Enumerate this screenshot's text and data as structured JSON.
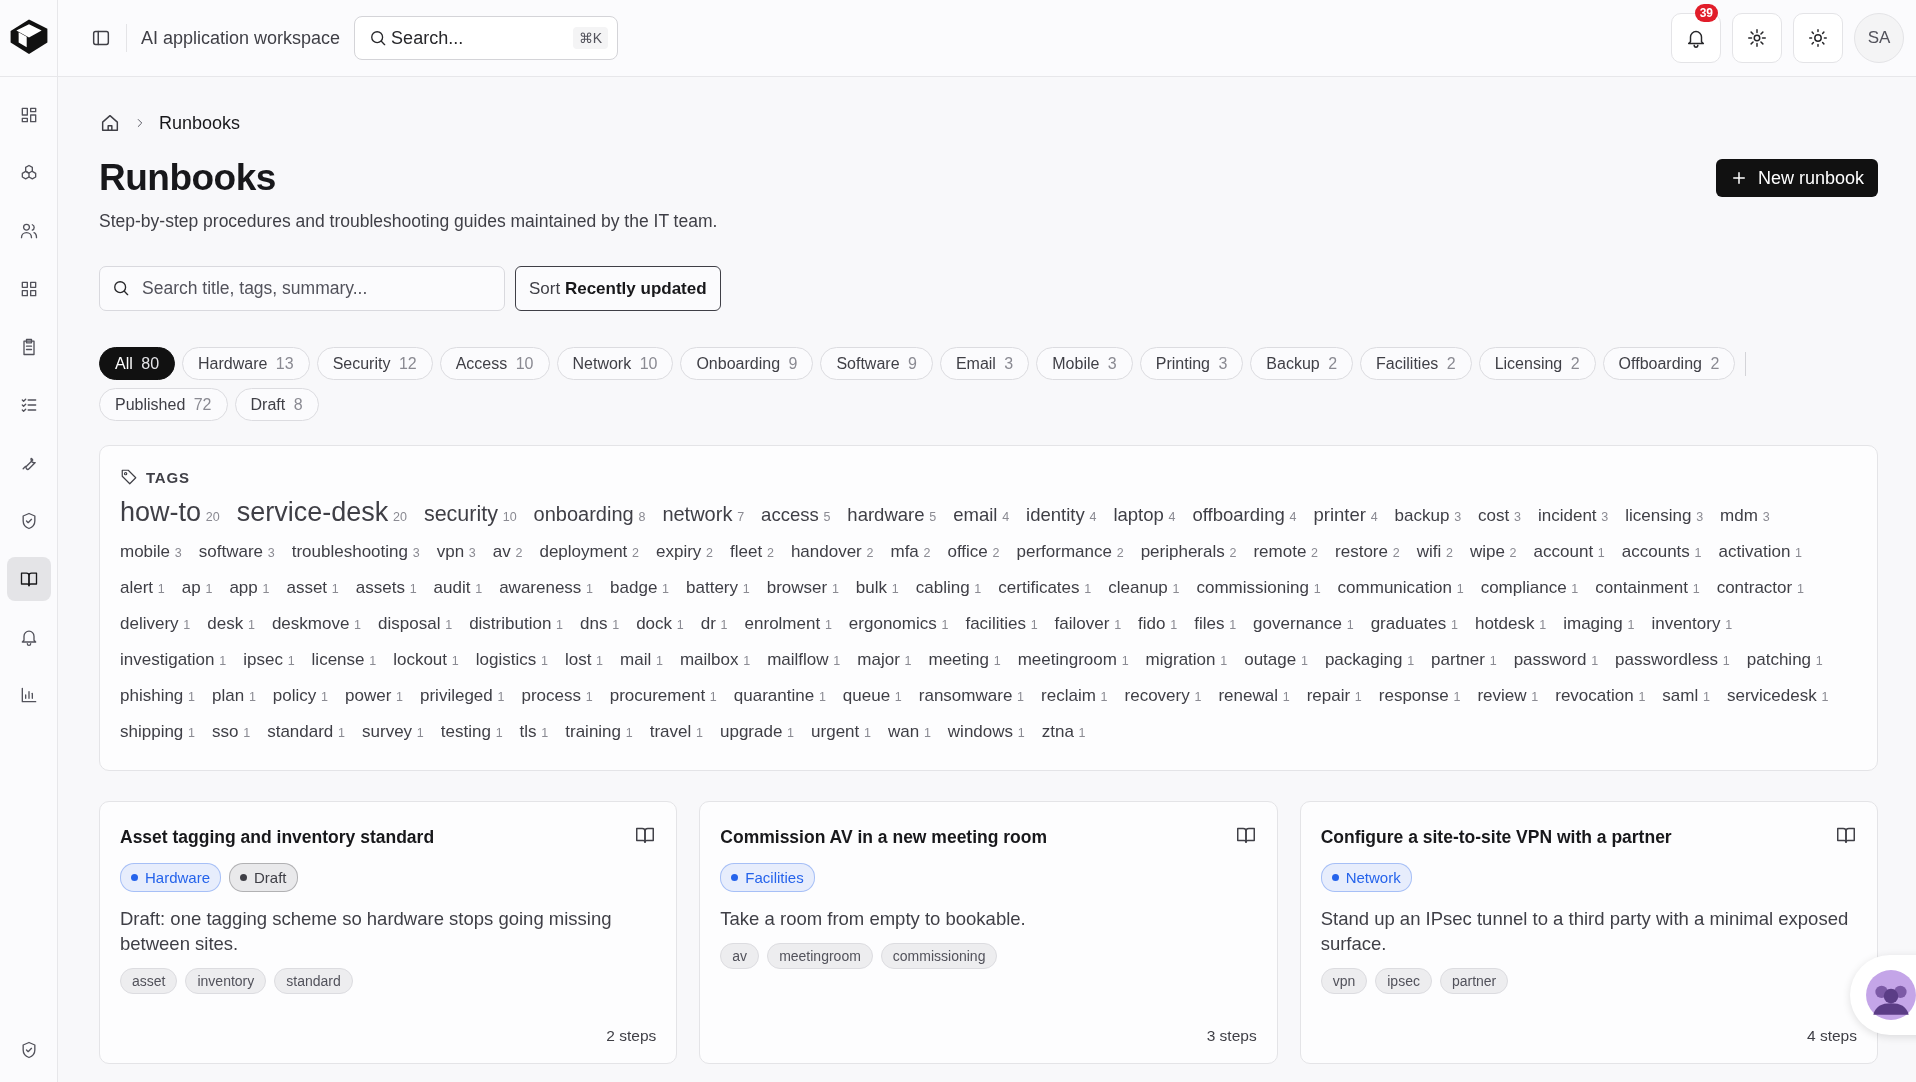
{
  "topbar": {
    "workspace": "AI application workspace",
    "search": {
      "placeholder": "Search...",
      "shortcut": "⌘K"
    },
    "notifications": "39",
    "avatar": "SA"
  },
  "sidebar": {
    "items": [
      {
        "kind": "dashboard",
        "selected": false
      },
      {
        "kind": "cubes",
        "selected": false
      },
      {
        "kind": "users",
        "selected": false
      },
      {
        "kind": "apps",
        "selected": false
      },
      {
        "kind": "clipboard",
        "selected": false
      },
      {
        "kind": "checklist",
        "selected": false
      },
      {
        "kind": "wrench",
        "selected": false
      },
      {
        "kind": "shield",
        "selected": false
      },
      {
        "kind": "book",
        "selected": true
      },
      {
        "kind": "bell",
        "selected": false
      },
      {
        "kind": "chart",
        "selected": false
      }
    ],
    "footer": {
      "kind": "shield",
      "selected": false
    }
  },
  "breadcrumb": [
    "Runbooks"
  ],
  "title": "Runbooks",
  "subtitle": "Step-by-step procedures and troubleshooting guides maintained by the IT team.",
  "new_button": "New runbook",
  "search": {
    "placeholder": "Search title, tags, summary..."
  },
  "sort": {
    "label": "Sort",
    "value": "Recently updated"
  },
  "filter_groups": [
    [
      {
        "label": "All",
        "count": "80",
        "selected": true
      },
      {
        "label": "Hardware",
        "count": "13",
        "selected": false
      },
      {
        "label": "Security",
        "count": "12",
        "selected": false
      },
      {
        "label": "Access",
        "count": "10",
        "selected": false
      },
      {
        "label": "Network",
        "count": "10",
        "selected": false
      },
      {
        "label": "Onboarding",
        "count": "9",
        "selected": false
      },
      {
        "label": "Software",
        "count": "9",
        "selected": false
      },
      {
        "label": "Email",
        "count": "3",
        "selected": false
      },
      {
        "label": "Mobile",
        "count": "3",
        "selected": false
      },
      {
        "label": "Printing",
        "count": "3",
        "selected": false
      },
      {
        "label": "Backup",
        "count": "2",
        "selected": false
      },
      {
        "label": "Facilities",
        "count": "2",
        "selected": false
      },
      {
        "label": "Licensing",
        "count": "2",
        "selected": false
      },
      {
        "label": "Offboarding",
        "count": "2",
        "selected": false
      }
    ],
    [
      {
        "label": "Published",
        "count": "72",
        "selected": false
      },
      {
        "label": "Draft",
        "count": "8",
        "selected": false
      }
    ]
  ],
  "tags": {
    "heading": "TAGS",
    "items": [
      [
        "how-to",
        "20"
      ],
      [
        "service-desk",
        "20"
      ],
      [
        "security",
        "10"
      ],
      [
        "onboarding",
        "8"
      ],
      [
        "network",
        "7"
      ],
      [
        "access",
        "5"
      ],
      [
        "hardware",
        "5"
      ],
      [
        "email",
        "4"
      ],
      [
        "identity",
        "4"
      ],
      [
        "laptop",
        "4"
      ],
      [
        "offboarding",
        "4"
      ],
      [
        "printer",
        "4"
      ],
      [
        "backup",
        "3"
      ],
      [
        "cost",
        "3"
      ],
      [
        "incident",
        "3"
      ],
      [
        "licensing",
        "3"
      ],
      [
        "mdm",
        "3"
      ],
      [
        "mobile",
        "3"
      ],
      [
        "software",
        "3"
      ],
      [
        "troubleshooting",
        "3"
      ],
      [
        "vpn",
        "3"
      ],
      [
        "av",
        "2"
      ],
      [
        "deployment",
        "2"
      ],
      [
        "expiry",
        "2"
      ],
      [
        "fleet",
        "2"
      ],
      [
        "handover",
        "2"
      ],
      [
        "mfa",
        "2"
      ],
      [
        "office",
        "2"
      ],
      [
        "performance",
        "2"
      ],
      [
        "peripherals",
        "2"
      ],
      [
        "remote",
        "2"
      ],
      [
        "restore",
        "2"
      ],
      [
        "wifi",
        "2"
      ],
      [
        "wipe",
        "2"
      ],
      [
        "account",
        "1"
      ],
      [
        "accounts",
        "1"
      ],
      [
        "activation",
        "1"
      ],
      [
        "alert",
        "1"
      ],
      [
        "ap",
        "1"
      ],
      [
        "app",
        "1"
      ],
      [
        "asset",
        "1"
      ],
      [
        "assets",
        "1"
      ],
      [
        "audit",
        "1"
      ],
      [
        "awareness",
        "1"
      ],
      [
        "badge",
        "1"
      ],
      [
        "battery",
        "1"
      ],
      [
        "browser",
        "1"
      ],
      [
        "bulk",
        "1"
      ],
      [
        "cabling",
        "1"
      ],
      [
        "certificates",
        "1"
      ],
      [
        "cleanup",
        "1"
      ],
      [
        "commissioning",
        "1"
      ],
      [
        "communication",
        "1"
      ],
      [
        "compliance",
        "1"
      ],
      [
        "containment",
        "1"
      ],
      [
        "contractor",
        "1"
      ],
      [
        "delivery",
        "1"
      ],
      [
        "desk",
        "1"
      ],
      [
        "deskmove",
        "1"
      ],
      [
        "disposal",
        "1"
      ],
      [
        "distribution",
        "1"
      ],
      [
        "dns",
        "1"
      ],
      [
        "dock",
        "1"
      ],
      [
        "dr",
        "1"
      ],
      [
        "enrolment",
        "1"
      ],
      [
        "ergonomics",
        "1"
      ],
      [
        "facilities",
        "1"
      ],
      [
        "failover",
        "1"
      ],
      [
        "fido",
        "1"
      ],
      [
        "files",
        "1"
      ],
      [
        "governance",
        "1"
      ],
      [
        "graduates",
        "1"
      ],
      [
        "hotdesk",
        "1"
      ],
      [
        "imaging",
        "1"
      ],
      [
        "inventory",
        "1"
      ],
      [
        "investigation",
        "1"
      ],
      [
        "ipsec",
        "1"
      ],
      [
        "license",
        "1"
      ],
      [
        "lockout",
        "1"
      ],
      [
        "logistics",
        "1"
      ],
      [
        "lost",
        "1"
      ],
      [
        "mail",
        "1"
      ],
      [
        "mailbox",
        "1"
      ],
      [
        "mailflow",
        "1"
      ],
      [
        "major",
        "1"
      ],
      [
        "meeting",
        "1"
      ],
      [
        "meetingroom",
        "1"
      ],
      [
        "migration",
        "1"
      ],
      [
        "outage",
        "1"
      ],
      [
        "packaging",
        "1"
      ],
      [
        "partner",
        "1"
      ],
      [
        "password",
        "1"
      ],
      [
        "passwordless",
        "1"
      ],
      [
        "patching",
        "1"
      ],
      [
        "phishing",
        "1"
      ],
      [
        "plan",
        "1"
      ],
      [
        "policy",
        "1"
      ],
      [
        "power",
        "1"
      ],
      [
        "privileged",
        "1"
      ],
      [
        "process",
        "1"
      ],
      [
        "procurement",
        "1"
      ],
      [
        "quarantine",
        "1"
      ],
      [
        "queue",
        "1"
      ],
      [
        "ransomware",
        "1"
      ],
      [
        "reclaim",
        "1"
      ],
      [
        "recovery",
        "1"
      ],
      [
        "renewal",
        "1"
      ],
      [
        "repair",
        "1"
      ],
      [
        "response",
        "1"
      ],
      [
        "review",
        "1"
      ],
      [
        "revocation",
        "1"
      ],
      [
        "saml",
        "1"
      ],
      [
        "servicedesk",
        "1"
      ],
      [
        "shipping",
        "1"
      ],
      [
        "sso",
        "1"
      ],
      [
        "standard",
        "1"
      ],
      [
        "survey",
        "1"
      ],
      [
        "testing",
        "1"
      ],
      [
        "tls",
        "1"
      ],
      [
        "training",
        "1"
      ],
      [
        "travel",
        "1"
      ],
      [
        "upgrade",
        "1"
      ],
      [
        "urgent",
        "1"
      ],
      [
        "wan",
        "1"
      ],
      [
        "windows",
        "1"
      ],
      [
        "ztna",
        "1"
      ]
    ]
  },
  "cards": [
    {
      "title": "Asset tagging and inventory standard",
      "badges": [
        {
          "label": "Hardware",
          "color": "#2563eb"
        },
        {
          "label": "Draft",
          "color": "#3f3f46"
        }
      ],
      "summary": "Draft: one tagging scheme so hardware stops going missing between sites.",
      "tags": [
        "asset",
        "inventory",
        "standard"
      ],
      "steps": "2 steps"
    },
    {
      "title": "Commission AV in a new meeting room",
      "badges": [
        {
          "label": "Facilities",
          "color": "#2563eb"
        }
      ],
      "summary": "Take a room from empty to bookable.",
      "tags": [
        "av",
        "meetingroom",
        "commissioning"
      ],
      "steps": "3 steps"
    },
    {
      "title": "Configure a site-to-site VPN with a partner",
      "badges": [
        {
          "label": "Network",
          "color": "#2563eb"
        }
      ],
      "summary": "Stand up an IPsec tunnel to a third party with a minimal exposed surface.",
      "tags": [
        "vpn",
        "ipsec",
        "partner"
      ],
      "steps": "4 steps"
    }
  ]
}
